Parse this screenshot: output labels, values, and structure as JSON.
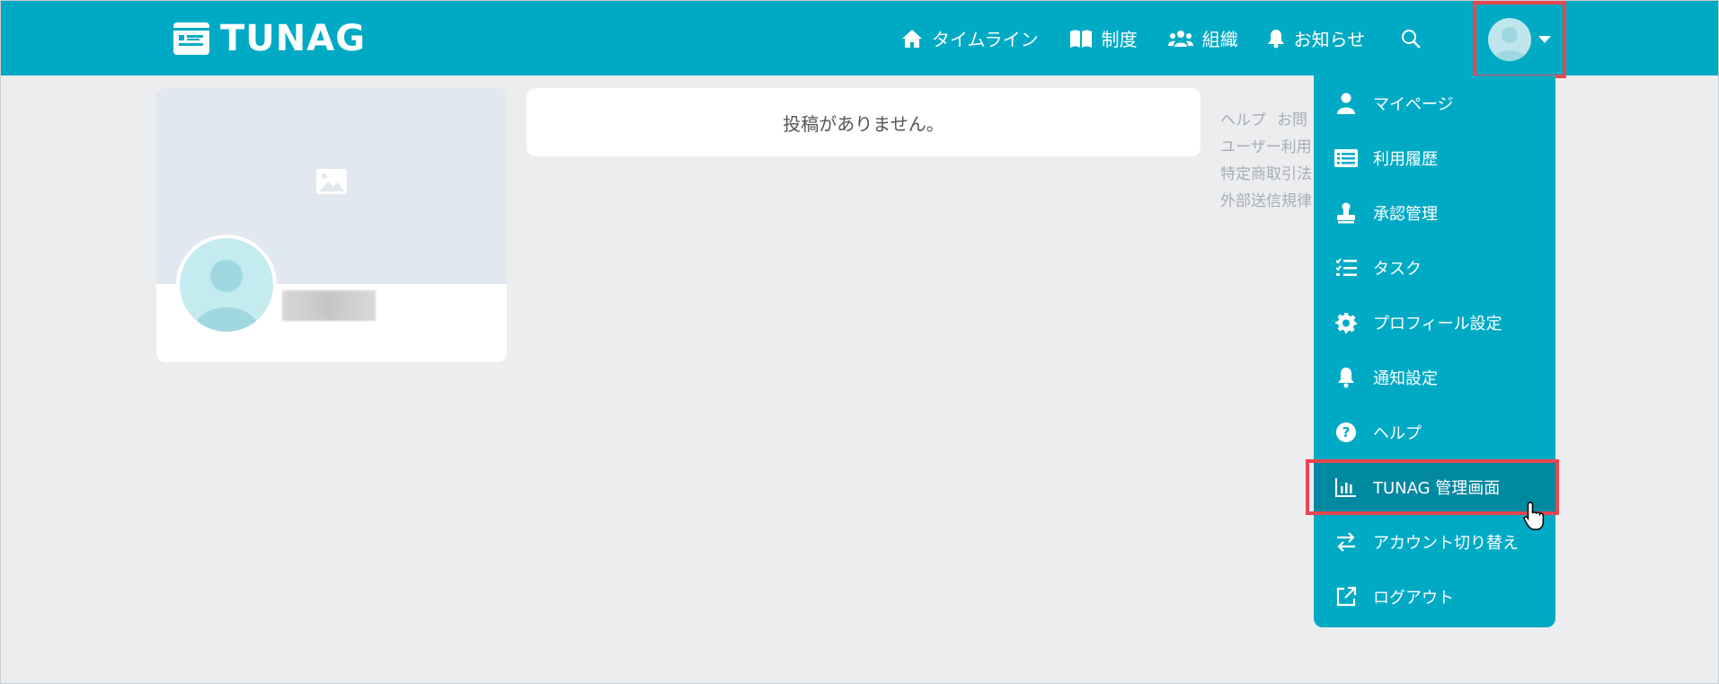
{
  "app": {
    "logo_text": "TUNAG"
  },
  "nav": {
    "timeline": "タイムライン",
    "system": "制度",
    "organization": "組織",
    "notifications": "お知らせ"
  },
  "main": {
    "empty_message": "投稿がありません。"
  },
  "footer_links": {
    "row1": [
      "ヘルプ",
      "お問"
    ],
    "row2": "ユーザー利用",
    "row3": "特定商取引法",
    "row4": "外部送信規律"
  },
  "menu": {
    "items": [
      {
        "label": "マイページ",
        "icon": "person-icon"
      },
      {
        "label": "利用履歴",
        "icon": "list-icon"
      },
      {
        "label": "承認管理",
        "icon": "stamp-icon"
      },
      {
        "label": "タスク",
        "icon": "checklist-icon"
      },
      {
        "label": "プロフィール設定",
        "icon": "gear-icon"
      },
      {
        "label": "通知設定",
        "icon": "bell-icon"
      },
      {
        "label": "ヘルプ",
        "icon": "question-icon"
      },
      {
        "label": "TUNAG 管理画面",
        "icon": "bar-chart-icon"
      },
      {
        "label": "アカウント切り替え",
        "icon": "swap-icon"
      },
      {
        "label": "ログアウト",
        "icon": "external-link-icon"
      }
    ]
  },
  "colors": {
    "brand": "#00aac5",
    "menu_active": "#0089a1",
    "highlight": "#e8454f",
    "background": "#ecedef"
  }
}
